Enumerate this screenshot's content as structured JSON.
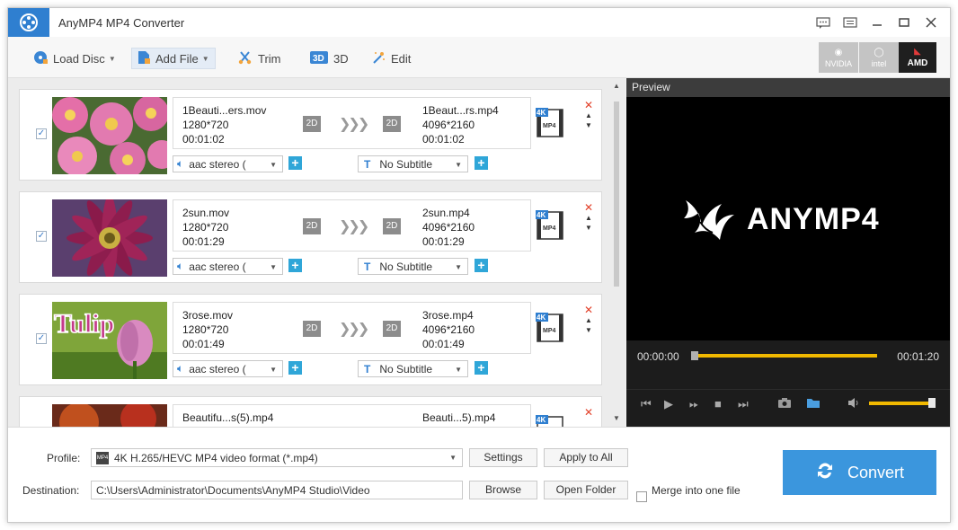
{
  "window": {
    "title": "AnyMP4 MP4 Converter"
  },
  "toolbar": {
    "load_disc": "Load Disc",
    "add_file": "Add File",
    "trim": "Trim",
    "three_d": "3D",
    "edit": "Edit",
    "hw": {
      "nvidia": "NVIDIA",
      "intel": "intel",
      "amd": "AMD"
    }
  },
  "files": [
    {
      "src_name": "1Beauti...ers.mov",
      "src_res": "1280*720",
      "src_dur": "00:01:02",
      "src_dim": "2D",
      "dst_dim": "2D",
      "dst_name": "1Beaut...rs.mp4",
      "dst_res": "4096*2160",
      "dst_dur": "00:01:02",
      "audio": "aac stereo (",
      "subtitle": "No Subtitle",
      "checked": "✓"
    },
    {
      "src_name": "2sun.mov",
      "src_res": "1280*720",
      "src_dur": "00:01:29",
      "src_dim": "2D",
      "dst_dim": "2D",
      "dst_name": "2sun.mp4",
      "dst_res": "4096*2160",
      "dst_dur": "00:01:29",
      "audio": "aac stereo (",
      "subtitle": "No Subtitle",
      "checked": "✓"
    },
    {
      "src_name": "3rose.mov",
      "src_res": "1280*720",
      "src_dur": "00:01:49",
      "src_dim": "2D",
      "dst_dim": "2D",
      "dst_name": "3rose.mp4",
      "dst_res": "4096*2160",
      "dst_dur": "00:01:49",
      "audio": "aac stereo (",
      "subtitle": "No Subtitle",
      "thumb_text": "Tulip",
      "checked": "✓"
    },
    {
      "src_name": "Beautifu...s(5).mp4",
      "dst_name": "Beauti...5).mp4"
    }
  ],
  "preview": {
    "header": "Preview",
    "logo_text": "ANYMP4",
    "time_current": "00:00:00",
    "time_total": "00:01:20"
  },
  "bottom": {
    "profile_label": "Profile:",
    "profile_value": "4K H.265/HEVC MP4 video format (*.mp4)",
    "settings": "Settings",
    "apply_all": "Apply to All",
    "destination_label": "Destination:",
    "destination_value": "C:\\Users\\Administrator\\Documents\\AnyMP4 Studio\\Video",
    "browse": "Browse",
    "open_folder": "Open Folder",
    "merge": "Merge into one file",
    "convert": "Convert"
  },
  "colors": {
    "accent": "#3b96dd",
    "seek": "#f0b800",
    "plus": "#2fa6d8",
    "delete": "#e2412a"
  }
}
